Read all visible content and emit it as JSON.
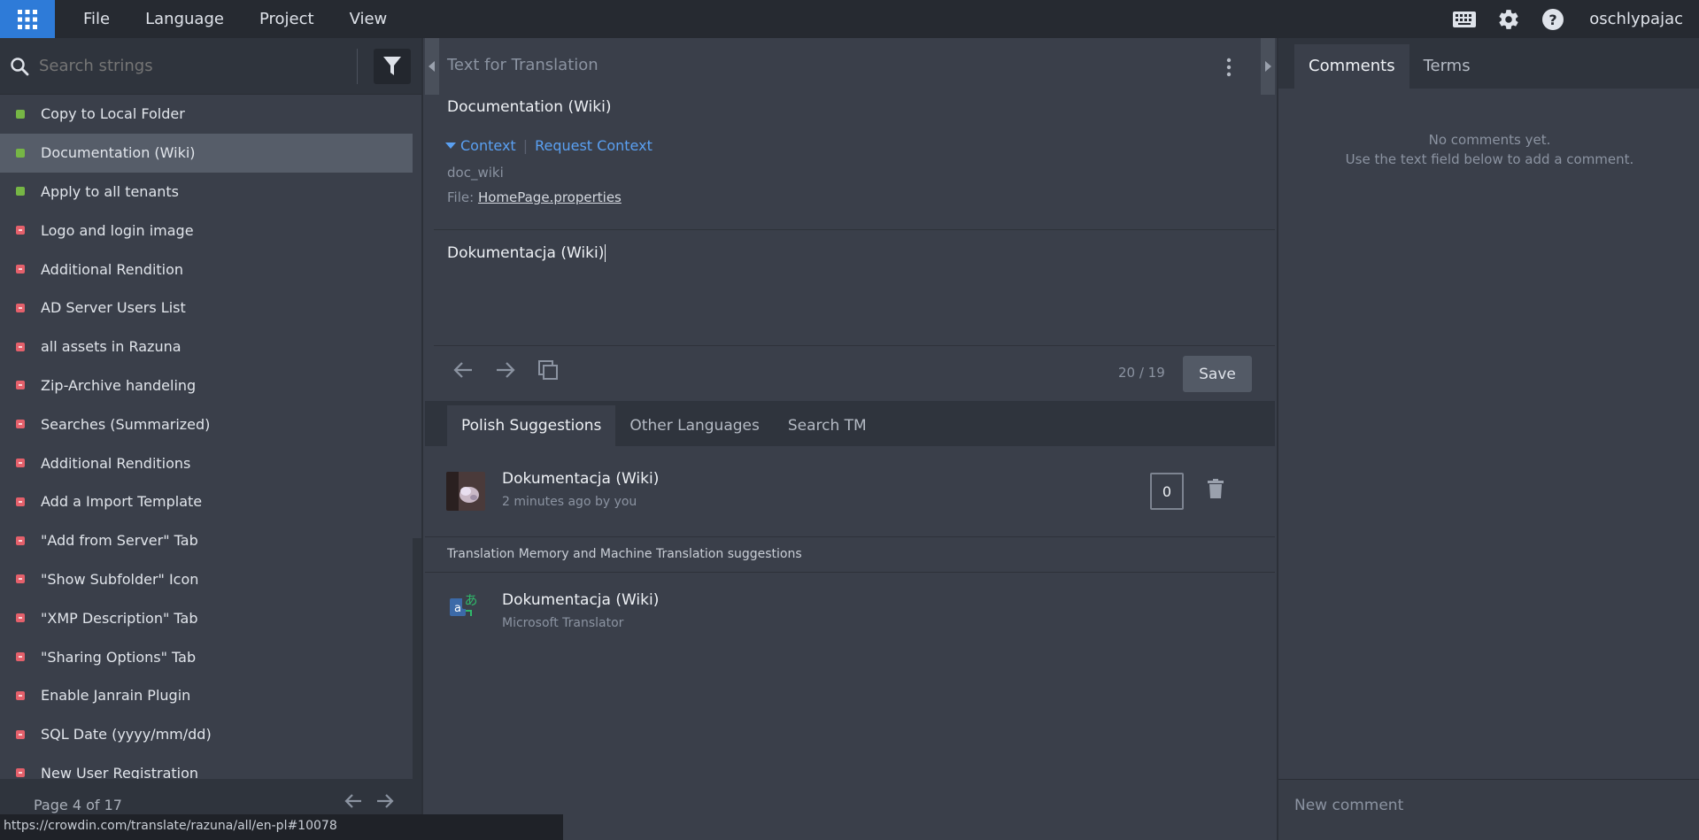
{
  "topbar": {
    "menu": [
      "File",
      "Language",
      "Project",
      "View"
    ],
    "username": "oschlypajac",
    "icons": [
      "apps-icon",
      "keyboard-icon",
      "gear-icon",
      "help-icon"
    ]
  },
  "left": {
    "search_placeholder": "Search strings",
    "strings": [
      {
        "label": "Copy to Local Folder",
        "status": "translated"
      },
      {
        "label": "Documentation (Wiki)",
        "status": "translated",
        "selected": true
      },
      {
        "label": "Apply to all tenants",
        "status": "translated"
      },
      {
        "label": "Logo and login image",
        "status": "untranslated"
      },
      {
        "label": "Additional Rendition",
        "status": "untranslated"
      },
      {
        "label": "AD Server Users List",
        "status": "untranslated"
      },
      {
        "label": "all assets in Razuna",
        "status": "untranslated"
      },
      {
        "label": "Zip-Archive handeling",
        "status": "untranslated"
      },
      {
        "label": "Searches (Summarized)",
        "status": "untranslated"
      },
      {
        "label": "Additional Renditions",
        "status": "untranslated"
      },
      {
        "label": "Add a Import Template",
        "status": "untranslated"
      },
      {
        "label": "\"Add from Server\" Tab",
        "status": "untranslated"
      },
      {
        "label": "\"Show Subfolder\" Icon",
        "status": "untranslated"
      },
      {
        "label": "\"XMP Description\" Tab",
        "status": "untranslated"
      },
      {
        "label": "\"Sharing Options\" Tab",
        "status": "untranslated"
      },
      {
        "label": "Enable Janrain Plugin",
        "status": "untranslated"
      },
      {
        "label": "SQL Date (yyyy/mm/dd)",
        "status": "untranslated"
      },
      {
        "label": "New User Registration",
        "status": "untranslated"
      }
    ],
    "status_colors": {
      "translated": "#76b645",
      "untranslated": "#e4606b"
    },
    "page_label": "Page 4 of 17"
  },
  "statusbar_url": "https://crowdin.com/translate/razuna/all/en-pl#10078",
  "editor": {
    "source_label": "Text for Translation",
    "source_text": "Documentation (Wiki)",
    "context_link": "Context",
    "request_context": "Request Context",
    "key": "doc_wiki",
    "file_prefix": "File:",
    "file_name": "HomePage.properties",
    "translation": "Dokumentacja (Wiki)",
    "counter": "20 / 19",
    "save_label": "Save"
  },
  "suggestions": {
    "tabs": [
      "Polish Suggestions",
      "Other Languages",
      "Search TM"
    ],
    "user_suggestion": {
      "text": "Dokumentacja (Wiki)",
      "meta": "2 minutes ago by you",
      "votes": "0"
    },
    "tm_header": "Translation Memory and Machine Translation suggestions",
    "mt_suggestion": {
      "text": "Dokumentacja (Wiki)",
      "meta": "Microsoft Translator"
    }
  },
  "comments": {
    "tabs": [
      "Comments",
      "Terms"
    ],
    "empty_line1": "No comments yet.",
    "empty_line2": "Use the text field below to add a comment.",
    "new_comment_placeholder": "New comment"
  }
}
